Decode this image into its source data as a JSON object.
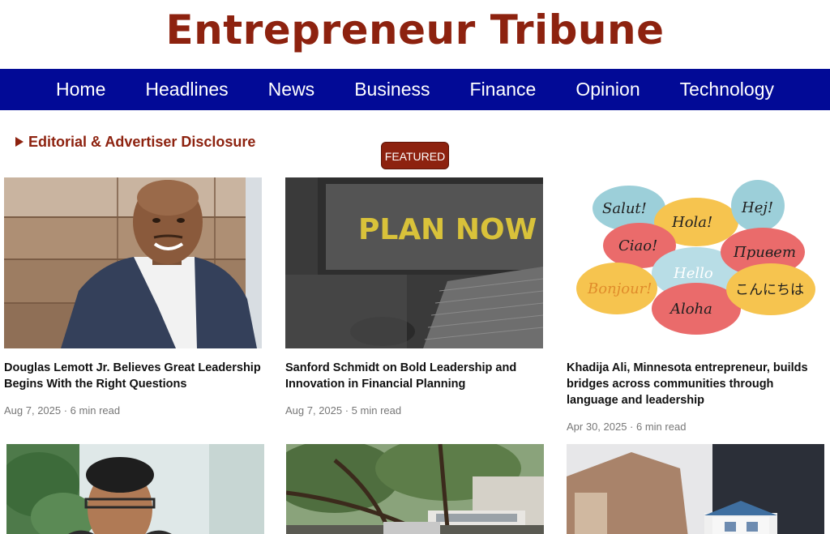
{
  "site": {
    "title": "Entrepreneur Tribune"
  },
  "nav": {
    "items": [
      "Home",
      "Headlines",
      "News",
      "Business",
      "Finance",
      "Opinion",
      "Technology"
    ]
  },
  "disclosure": {
    "label": "Editorial & Advertiser Disclosure"
  },
  "featured": {
    "label": "FEATURED"
  },
  "articles": [
    {
      "title": "Douglas Lemott Jr. Believes Great Leadership Begins With the Right Questions",
      "date": "Aug 7, 2025",
      "read_time": "6 min read",
      "meta": "Aug 7, 2025 · 6 min read"
    },
    {
      "title": "Sanford Schmidt on Bold Leadership and Innovation in Financial Planning",
      "date": "Aug 7, 2025",
      "read_time": "5 min read",
      "meta": "Aug 7, 2025 · 5 min read",
      "image_text": "PLAN NOW"
    },
    {
      "title": "Khadija Ali, Minnesota entrepreneur, builds bridges across communities through language and leadership",
      "date": "Apr 30, 2025",
      "read_time": "6 min read",
      "meta": "Apr 30, 2025 · 6 min read",
      "bubbles": [
        "Salut!",
        "Hola!",
        "Hej!",
        "Ciao!",
        "Hello",
        "Привет",
        "Bonjour!",
        "Aloha",
        "こんにちは"
      ]
    }
  ],
  "colors": {
    "brand": "#8d220f",
    "nav_bg": "#020a96",
    "meta_text": "#777777"
  }
}
